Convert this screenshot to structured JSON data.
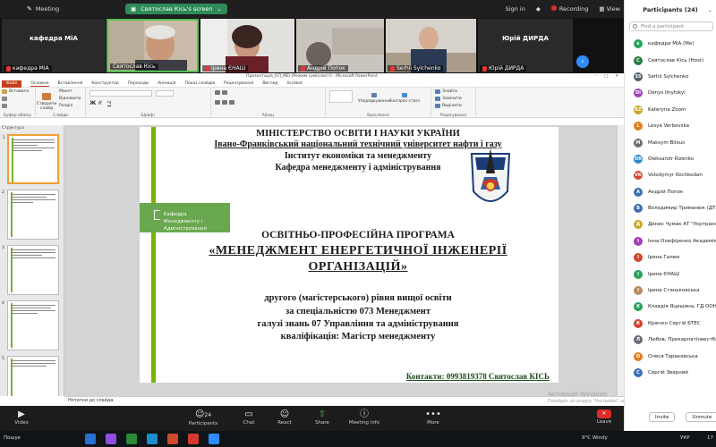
{
  "zoom": {
    "app_title": "Meeting",
    "share_label": "Святослав Кісь's screen",
    "signin": "Sign in",
    "recording": "Recording",
    "view": "View"
  },
  "tiles": [
    {
      "name": "кафедра МіА",
      "style": "name",
      "color": "#2a2a2a"
    },
    {
      "name": "Святослав Кісь",
      "style": "video",
      "color": "#9a8a72"
    },
    {
      "name": "Ірина ЄНАШ",
      "style": "video",
      "color": "#5d4d46"
    },
    {
      "name": "Андрій Попок",
      "style": "video",
      "color": "#7e7a72"
    },
    {
      "name": "Serhii Sylchenko",
      "style": "video",
      "color": "#6f6a63"
    },
    {
      "name": "Юрій ДИРДА",
      "style": "name",
      "color": "#2a2a2a"
    }
  ],
  "ppt": {
    "title": "Презентація_ОП_МЕІ [Режим сумісності] - Microsoft PowerPoint",
    "tabs": [
      "Файл",
      "Основне",
      "Вставлення",
      "Конструктор",
      "Переходи",
      "Анімація",
      "Показ слайдів",
      "Рецензування",
      "Вигляд",
      "Acrobat"
    ],
    "groups": [
      "Буфер обміну",
      "Слайди",
      "Шрифт",
      "Абзац",
      "Креслення",
      "Редагування"
    ],
    "ribbon": {
      "paste": "Вставити",
      "new_slide": "Створити слайд",
      "layout": "Макет",
      "reset": "Відновити",
      "section": "Розділ",
      "arrange": "Упорядкування",
      "quick_styles": "Експрес-стилі",
      "find": "Знайти",
      "replace": "Замінити",
      "select": "Виділити"
    },
    "thumbs_header": "Структура",
    "notes_placeholder": "Нотатки до слайда"
  },
  "slide": {
    "ministry": "МІНІСТЕРСТВО ОСВІТИ І НАУКИ УКРАЇНИ",
    "university": "Івано-Франківський національний технічний університет нафти і газу",
    "institute": "Інститут економіки та менеджменту",
    "department": "Кафедра менеджменту і адміністрування",
    "logo_text": [
      "Кафедра",
      "Менеджменту і",
      "Адміністрування"
    ],
    "program_label": "ОСВІТНЬО-ПРОФЕСІЙНА ПРОГРАМА",
    "program_name_1": "«МЕНЕДЖМЕНТ ЕНЕРГЕТИЧНОЇ ІНЖЕНЕРІЇ",
    "program_name_2": "ОРГАНІЗАЦІЙ»",
    "level": "другого (магістерського) рівня вищої освіти",
    "specialty": "за спеціальністю 073 Менеджмент",
    "field": "галузі знань 07 Управління та адміністрування",
    "qualification": "кваліфікація: Магістр менеджменту",
    "contacts": "Контакти: 0993819378 Святослав КІСЬ"
  },
  "windows_activation": {
    "line1": "Активація Windows",
    "line2": "Перейдіть до розділу \"Настройки\", щоб активувати Windows."
  },
  "toolbar": {
    "video": "Video",
    "participants": "Participants",
    "participants_count": "24",
    "chat": "Chat",
    "react": "React",
    "share": "Share",
    "meeting_info": "Meeting info",
    "more": "More",
    "leave": "Leave"
  },
  "taskbar": {
    "search": "Пошук",
    "weather": "9°C Windy",
    "lang": "УКР",
    "time": "17"
  },
  "panel": {
    "title": "Participants (24)",
    "search_placeholder": "Find a participant",
    "participants": [
      {
        "name": "кафедра МіА (Me)",
        "initial": "к",
        "color": "#27a35a"
      },
      {
        "name": "Святослав Кісь (Host)",
        "initial": "С",
        "color": "#2d7a46"
      },
      {
        "name": "Serhii Sylchenko",
        "initial": "SS",
        "color": "#545c66"
      },
      {
        "name": "Denys Ilnytskyi",
        "initial": "DI",
        "color": "#a23fb6"
      },
      {
        "name": "Kateryna Zoom",
        "initial": "KZ",
        "color": "#c9a72a"
      },
      {
        "name": "Lesya Verbovska",
        "initial": "L",
        "color": "#e07d1c"
      },
      {
        "name": "Maksym Bilous",
        "initial": "M",
        "color": "#6a6f77"
      },
      {
        "name": "Oleksandr Rizenko",
        "initial": "OR",
        "color": "#2a8ac9"
      },
      {
        "name": "Volodymyr Kochkodan",
        "initial": "VK",
        "color": "#d2452e"
      },
      {
        "name": "Андрій Попок",
        "initial": "А",
        "color": "#3d6fb6"
      },
      {
        "name": "Володимир Триманюк (ДТЕ",
        "initial": "В",
        "color": "#3d6fb6"
      },
      {
        "name": "Денис Чумак АТ \"Укртранс",
        "initial": "Д",
        "color": "#c9a72a"
      },
      {
        "name": "Інна Олефіренко Академія",
        "initial": "І",
        "color": "#a23fb6"
      },
      {
        "name": "Ірина Галюк",
        "initial": "І",
        "color": "#d2452e"
      },
      {
        "name": "Ірина ЄНАШ",
        "initial": "І",
        "color": "#27a35a"
      },
      {
        "name": "Ірина Станьковська",
        "initial": "І",
        "color": "#b98a5e"
      },
      {
        "name": "Клавдія Яцишина, ГД ООН",
        "initial": "К",
        "color": "#27a35a"
      },
      {
        "name": "Крючко Сергій БТЕС",
        "initial": "К",
        "color": "#d2452e"
      },
      {
        "name": "Любов, Прикарпатїнвестбан",
        "initial": "Л",
        "color": "#6a6f77"
      },
      {
        "name": "Олеся Таракевська",
        "initial": "О",
        "color": "#e07d1c"
      },
      {
        "name": "Сергій Зварний",
        "initial": "С",
        "color": "#3d6fb6"
      }
    ],
    "invite": "Invite",
    "unmute": "Unmute"
  }
}
